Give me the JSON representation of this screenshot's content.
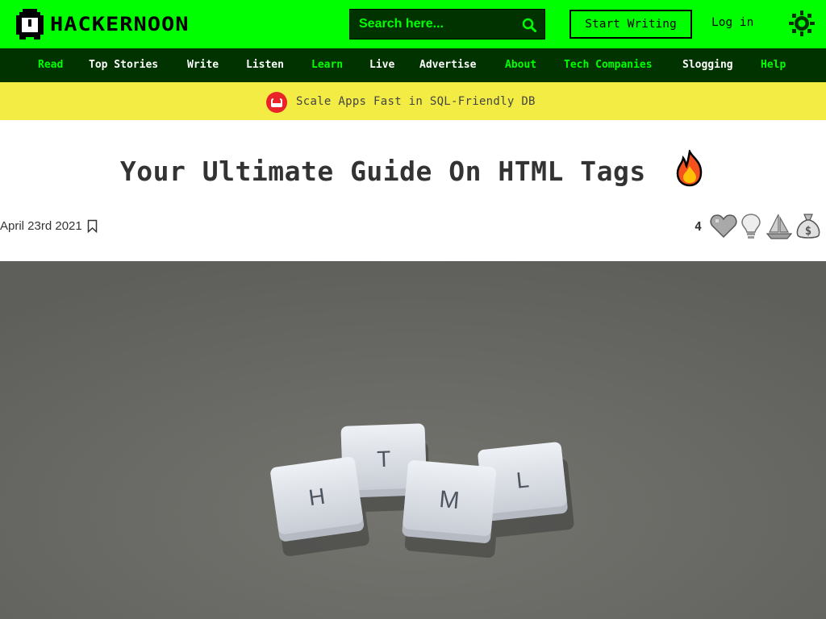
{
  "header": {
    "brand": "HACKERNOON",
    "search_placeholder": "Search here...",
    "start_writing": "Start Writing",
    "login": "Log in",
    "icons": {
      "logo": "hackernoon-logo-icon",
      "search": "search-icon",
      "theme": "sun-icon"
    }
  },
  "nav": {
    "items": [
      {
        "label": "Read",
        "color": "#00ff00"
      },
      {
        "label": "Top Stories",
        "color": "#ffffff"
      },
      {
        "label": "Write",
        "color": "#ffffff"
      },
      {
        "label": "Listen",
        "color": "#ffffff"
      },
      {
        "label": "Learn",
        "color": "#00ff00"
      },
      {
        "label": "Live",
        "color": "#ffffff"
      },
      {
        "label": "Advertise",
        "color": "#ffffff"
      },
      {
        "label": "About",
        "color": "#00ff00"
      },
      {
        "label": "Tech Companies",
        "color": "#00ff00"
      },
      {
        "label": "Slogging",
        "color": "#ffffff"
      },
      {
        "label": "Help",
        "color": "#00ff00"
      }
    ]
  },
  "banner": {
    "text": "Scale Apps Fast in SQL-Friendly DB",
    "icon": "couchbase-logo-icon"
  },
  "article": {
    "title": "Your Ultimate Guide On HTML Tags",
    "title_icon": "fire-emoji-icon",
    "date": "April 23rd 2021",
    "reaction_count": "4",
    "reactions": [
      "heart-icon",
      "lightbulb-icon",
      "boat-icon",
      "money-bag-icon"
    ],
    "hero_letters": [
      "H",
      "T",
      "M",
      "L"
    ]
  },
  "colors": {
    "brand_green": "#00ff00",
    "nav_dark": "#003300",
    "banner_yellow": "#f2ec44",
    "hero_gray": "#6b6b69"
  }
}
